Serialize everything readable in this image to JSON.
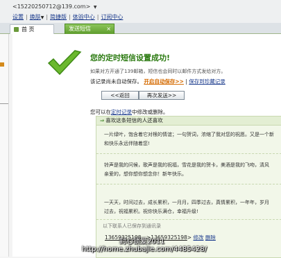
{
  "account": {
    "email": "<15220250712@139.com>",
    "arrow": "▼"
  },
  "top_links": {
    "settings": "设置",
    "skin": "换肤",
    "skin_arrow": "▼",
    "lite": "简捷版",
    "experience": "体验中心",
    "subscribe": "订阅中心"
  },
  "tabs": {
    "home": "首 页",
    "send_sms": "发送短信",
    "close": "×"
  },
  "success": {
    "title": "您的定时短信设置成功!",
    "note": "如果对方开通了139邮箱，短信也会同时以邮件方式发给对方。",
    "save_prefix": "该记录尚未自动保存。",
    "auto_save_link": "开启自动保存>>",
    "save_to_favorites": "保存到珍藏记录",
    "back_button": "<<返回",
    "resend_button": "再次发送>>",
    "view_prefix": "您可以在",
    "view_link": "定时记录",
    "view_suffix": "中修改或删除。"
  },
  "message_box": {
    "heading_mark": "⇒",
    "heading": "喜欢这条短信的人还喜欢",
    "messages": [
      [
        "一片绿叶，饱含着它对根的情谊；一句贺词，浓缩了我对您的祝愿。又是一个新",
        "和快乐永远伴随着您!"
      ],
      [
        "铃声是我的问候，歌声是我的祝福，雪花是我的贺卡，美酒是我的飞吻，清风",
        "亲爱的，想你想你想念你！新年快乐。"
      ],
      [
        "一天天，时间过去，成长累积，一月月，四季过去，真情累积，一年年，岁月",
        "过去，祝福累积。祝你快乐满仓，幸福升级!"
      ]
    ]
  },
  "history": {
    "title": "以下联系人已保存到通讯录",
    "contact_1": "13659325198",
    "separator": "、",
    "contact_2_prefix": ">",
    "contact_2": "13659325198",
    "contact_2_suffix": ">",
    "edit": "修改",
    "delete": "删除"
  },
  "watermark": {
    "text": "封心锁爱2011",
    "url": "http://home.zhubajie.com/4485428/"
  },
  "colors": {
    "accent_green": "#2b7a10",
    "tab_green": "#5f9d2e",
    "link_blue": "#1a3a8c",
    "link_orange": "#d46a00"
  }
}
